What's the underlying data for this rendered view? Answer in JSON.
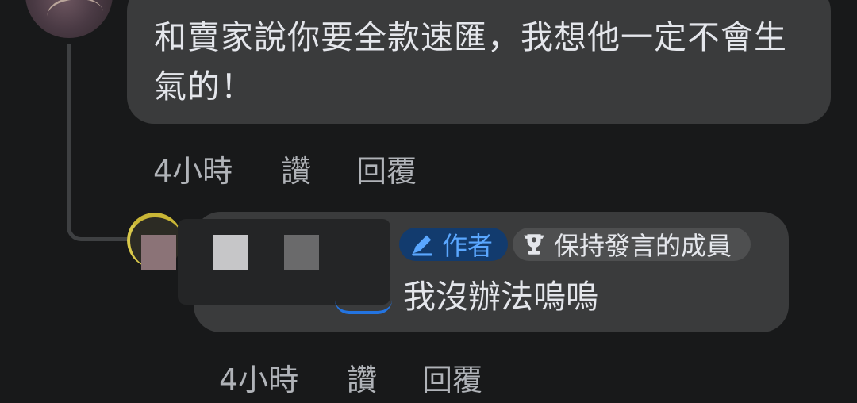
{
  "comments": [
    {
      "text": "和賣家說你要全款速匯，我想他一定不會生氣的！",
      "time": "4小時",
      "like": "讚",
      "reply": "回覆"
    },
    {
      "badges": {
        "author": "作者",
        "member": "保持發言的成員"
      },
      "text": "我沒辦法嗚嗚",
      "time": "4小時",
      "like": "讚",
      "reply": "回覆"
    }
  ],
  "colors": {
    "background": "#18191a",
    "bubble": "#3a3b3c",
    "author_badge_bg": "#123b6e",
    "author_badge_text": "#5aa7ff",
    "secondary_text": "#b0b3b8"
  },
  "icons": {
    "author": "pencil-icon",
    "member": "trophy-icon"
  }
}
